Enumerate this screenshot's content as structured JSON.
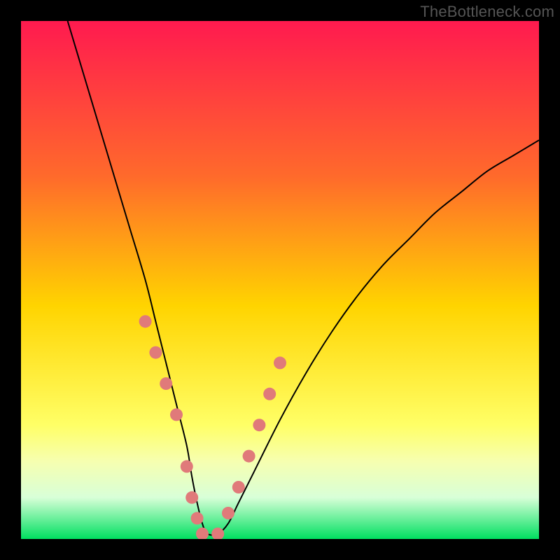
{
  "attribution": "TheBottleneck.com",
  "chart_data": {
    "type": "line",
    "title": "",
    "xlabel": "",
    "ylabel": "",
    "xlim": [
      0,
      100
    ],
    "ylim": [
      0,
      100
    ],
    "grid": false,
    "series": [
      {
        "name": "curve",
        "x": [
          9,
          12,
          15,
          18,
          21,
          24,
          26,
          28,
          30,
          32,
          33,
          34,
          35,
          36,
          38,
          40,
          42,
          45,
          50,
          55,
          60,
          65,
          70,
          75,
          80,
          85,
          90,
          95,
          100
        ],
        "values": [
          100,
          90,
          80,
          70,
          60,
          50,
          42,
          34,
          26,
          18,
          12,
          7,
          3,
          1,
          1,
          3,
          7,
          13,
          23,
          32,
          40,
          47,
          53,
          58,
          63,
          67,
          71,
          74,
          77
        ]
      }
    ],
    "gradient_stops": [
      {
        "offset": 0,
        "color": "#ff1a4f"
      },
      {
        "offset": 0.3,
        "color": "#ff6a2b"
      },
      {
        "offset": 0.55,
        "color": "#ffd400"
      },
      {
        "offset": 0.78,
        "color": "#ffff66"
      },
      {
        "offset": 0.85,
        "color": "#f6ffb0"
      },
      {
        "offset": 0.92,
        "color": "#d8ffd8"
      },
      {
        "offset": 1.0,
        "color": "#00e060"
      }
    ],
    "dots": {
      "color": "#e07a7a",
      "radius_px": 9,
      "x": [
        24,
        26,
        28,
        30,
        32,
        33,
        34,
        35,
        38,
        40,
        42,
        44,
        46,
        48,
        50
      ],
      "values": [
        42,
        36,
        30,
        24,
        14,
        8,
        4,
        1,
        1,
        5,
        10,
        16,
        22,
        28,
        34
      ]
    }
  }
}
